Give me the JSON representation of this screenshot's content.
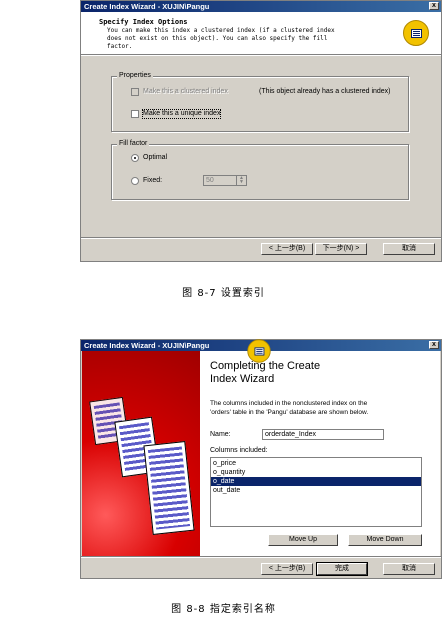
{
  "fig1": {
    "title": "Create Index Wizard - XUJIN\\Pangu",
    "close": "x",
    "header_title": "Specify Index Options",
    "header_desc": [
      "You can make this index a clustered index (if a clustered index",
      "does not exist on this object). You can also specify the fill",
      "factor."
    ],
    "properties_label": "Properties",
    "clustered_label": "Make this a clustered index",
    "clustered_note": "(This object already has a clustered index)",
    "unique_label": "Make this a unique index",
    "fillfactor_label": "Fill factor",
    "optimal_label": "Optimal",
    "fixed_label": "Fixed:",
    "fixed_value": "50",
    "back_btn": "< 上一步(B)",
    "next_btn": "下一步(N) >",
    "cancel_btn": "取消",
    "caption": "图 8-7 设置索引"
  },
  "fig2": {
    "title": "Create Index Wizard - XUJIN\\Pangu",
    "close": "x",
    "heading": [
      "Completing the Create",
      "Index Wizard"
    ],
    "desc": [
      "The columns included in the nonclustered index on the",
      "'orders' table in the 'Pangu' database are shown below."
    ],
    "name_label": "Name:",
    "name_value": "orderdate_Index",
    "columns_label": "Columns included:",
    "columns": [
      "o_price",
      "o_quantity",
      "o_date",
      "out_date"
    ],
    "selected_index": 2,
    "move_up": "Move Up",
    "move_down": "Move Down",
    "back_btn": "< 上一步(B)",
    "finish_btn": "完成",
    "cancel_btn": "取消",
    "caption": "图 8-8 指定索引名称"
  }
}
